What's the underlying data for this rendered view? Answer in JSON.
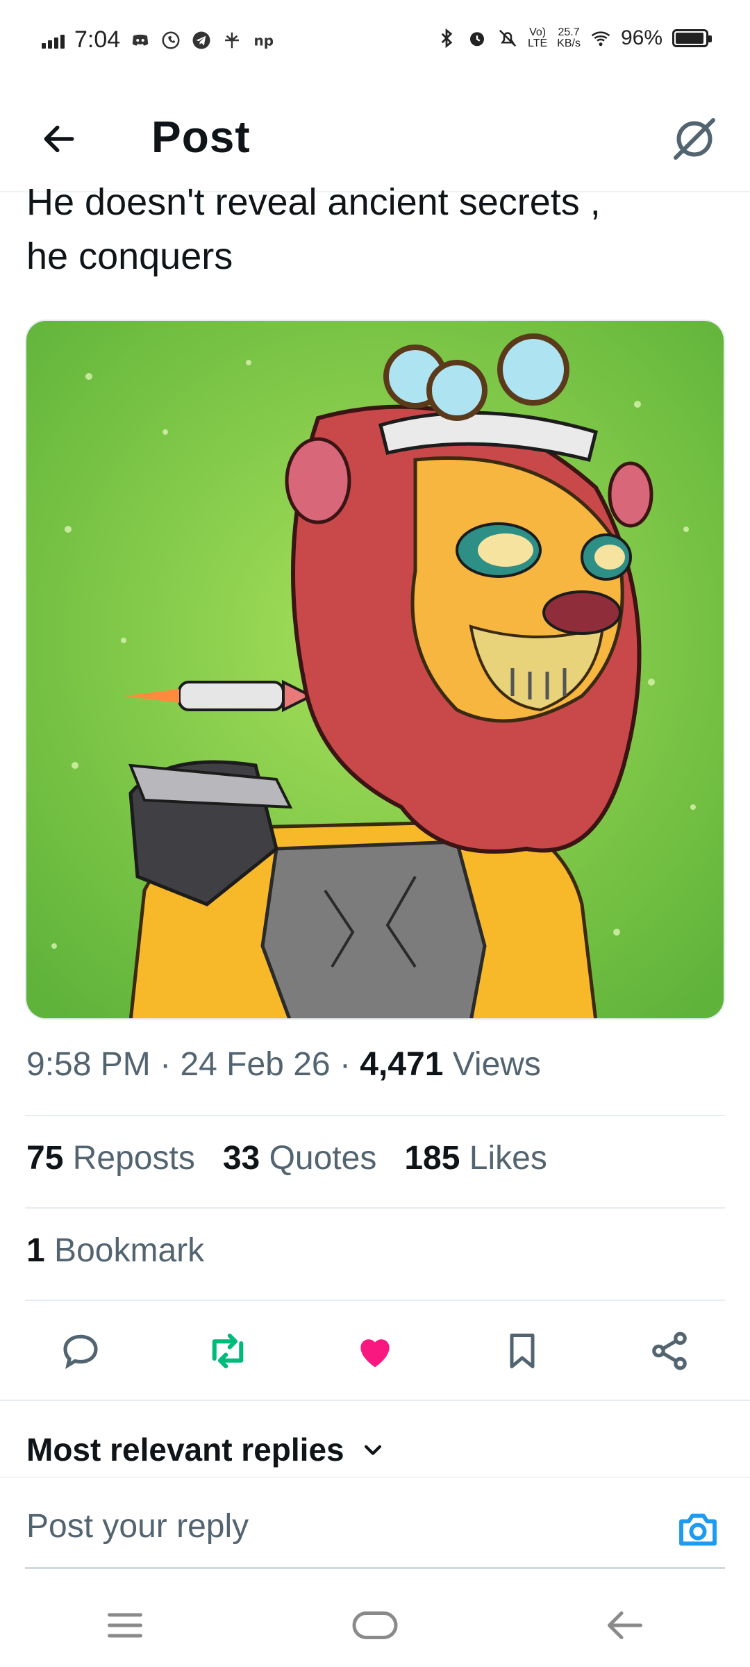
{
  "status_bar": {
    "time": "7:04",
    "net_speed_top": "25.7",
    "net_speed_bottom": "KB/s",
    "lte_top": "Vo)",
    "lte_bottom": "LTE",
    "battery": "96%",
    "battery_level": 0.96
  },
  "header": {
    "title": "Post"
  },
  "post": {
    "text_line1": "He doesn't reveal ancient secrets ,",
    "text_line2": "he conquers",
    "time": "9:58 PM",
    "date": "24 Feb 26",
    "views_count": "4,471",
    "views_label": "Views",
    "sep": "·"
  },
  "stats": {
    "reposts_count": "75",
    "reposts_label": "Reposts",
    "quotes_count": "33",
    "quotes_label": "Quotes",
    "likes_count": "185",
    "likes_label": "Likes",
    "bookmarks_count": "1",
    "bookmarks_label": "Bookmark"
  },
  "actions": [
    {
      "icon": "reply-icon"
    },
    {
      "icon": "repost-icon",
      "color": "#00ba7c"
    },
    {
      "icon": "like-icon",
      "color": "#f91880"
    },
    {
      "icon": "bookmark-icon"
    },
    {
      "icon": "share-icon"
    }
  ],
  "replies": {
    "sort_label": "Most relevant replies"
  },
  "reply_box": {
    "placeholder": "Post your reply",
    "accent": "#1d9bf0"
  },
  "colors": {
    "text": "#0f1419",
    "muted": "#536471",
    "divider": "#e6ecf0"
  }
}
